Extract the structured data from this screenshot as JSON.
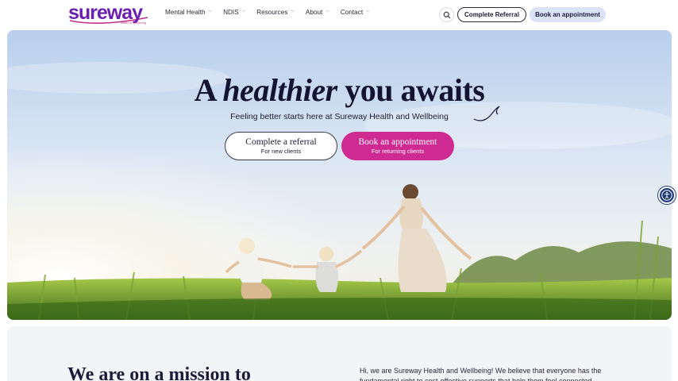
{
  "brand": {
    "logo_text": "sureway",
    "logo_tagline": "health & wellbeing"
  },
  "nav": {
    "items": [
      {
        "label": "Mental Health"
      },
      {
        "label": "NDIS"
      },
      {
        "label": "Resources"
      },
      {
        "label": "About"
      },
      {
        "label": "Contact"
      }
    ]
  },
  "header_actions": {
    "search_icon": "search-icon",
    "complete_referral": "Complete Referral",
    "book_appointment": "Book an appointment"
  },
  "hero": {
    "title_pre": "A ",
    "title_italic": "healthier",
    "title_post": " you awaits",
    "subtitle": "Feeling better starts here at Sureway Health and Wellbeing",
    "cta_referral": {
      "label": "Complete a referral",
      "sub": "For new clients"
    },
    "cta_appointment": {
      "label": "Book an appointment",
      "sub": "For returning clients"
    }
  },
  "accessibility": {
    "icon": "accessibility-icon"
  },
  "mission": {
    "title": "We are on a mission to",
    "text": "Hi, we are Sureway Health and Wellbeing! We believe that everyone has the fundamental right to cost-effective supports that help them feel connected"
  },
  "colors": {
    "brand_purple": "#6a1fb0",
    "brand_magenta": "#cf2a92",
    "appointment_bg": "#dce3f7",
    "a11y_blue": "#1f3a7a"
  }
}
